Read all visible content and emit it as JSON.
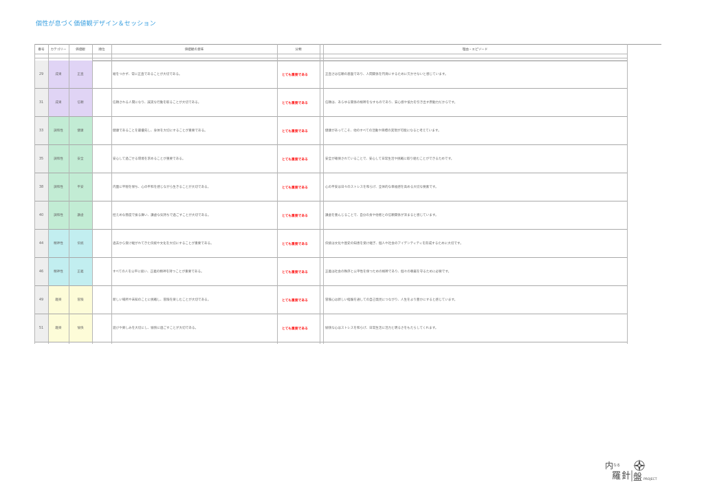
{
  "title": "個性が息づく価値観デザイン＆セッション",
  "columns": {
    "number": "番号",
    "category": "カテゴリー",
    "value": "価値観",
    "rank": "順位",
    "meaning": "価値観の意味",
    "classification": "分類",
    "reason": "理由・エピソード"
  },
  "colors": {
    "成果": "#e0d4f5",
    "調和性": "#c2ecd4",
    "精神性": "#c2eef0",
    "趣楽": "#fdfcd8",
    "classification": "#ff1a1a"
  },
  "rows": [
    {
      "num": "29",
      "category": "成果",
      "value": "正直",
      "meaning": "嘘をつかず、常に正直であることが大切である。",
      "classification": "とても重要である",
      "reason": "正直さは信頼の基盤であり、人間関係を円滑にするために欠かせないと感じています。"
    },
    {
      "num": "31",
      "category": "成果",
      "value": "信頼",
      "meaning": "信頼される人間になり、誠実な行動を取ることが大切である。",
      "classification": "とても重要である",
      "reason": "信頼は、あらゆる関係の根幹をなすものであり、安心感や協力を引き出す原動力だからです。"
    },
    {
      "num": "33",
      "category": "調和性",
      "value": "健康",
      "meaning": "健康であることを最優先し、身体を大切にすることが重要である。",
      "classification": "とても重要である",
      "reason": "健康があってこそ、他のすべての活動や目標の実現が可能になると考えています。"
    },
    {
      "num": "35",
      "category": "調和性",
      "value": "安全",
      "meaning": "安心して過ごせる環境を求めることが重要である。",
      "classification": "とても重要である",
      "reason": "安全が確保されていることで、安心して日常生活や挑戦に取り組むことができるためです。"
    },
    {
      "num": "38",
      "category": "調和性",
      "value": "平安",
      "meaning": "内面に平穏を保ち、心の平和を感じながら生きることが大切である。",
      "classification": "とても重要である",
      "reason": "心の平安は日々のストレスを和らげ、全体的な幸福感を高める大切な要素です。"
    },
    {
      "num": "40",
      "category": "調和性",
      "value": "謙虚",
      "meaning": "控えめな態度で振る舞い、謙虚な気持ちで過ごすことが大切である。",
      "classification": "とても重要である",
      "reason": "謙虚を重んじることで、自分の身や他者との信頼関係が深まると感じています。"
    },
    {
      "num": "44",
      "category": "精神性",
      "value": "伝統",
      "meaning": "過去から受け継がれてきた伝統や文化を大切にすることが重要である。",
      "classification": "とても重要である",
      "reason": "伝統は文化や歴史の知恵を受け継ぎ、個人や社会のアイデンティティを形成するために大切です。"
    },
    {
      "num": "46",
      "category": "精神性",
      "value": "正義",
      "meaning": "すべての人を公平に扱い、正義の精神を持つことが重要である。",
      "classification": "とても重要である",
      "reason": "正義は社会の秩序と公平性を保つための根幹であり、個々の尊厳を守るために必要です。"
    },
    {
      "num": "49",
      "category": "趣楽",
      "value": "冒険",
      "meaning": "新しい場所や未知のことに挑戦し、冒険を楽しむことが大切である。",
      "classification": "とても重要である",
      "reason": "冒険心は新しい経験を通しての自己発見につながり、人生をより豊かにすると感じています。"
    },
    {
      "num": "51",
      "category": "趣楽",
      "value": "愉快",
      "meaning": "遊びや楽しみを大切にし、愉快に過ごすことが大切である。",
      "classification": "とても重要である",
      "reason": "愉快な心はストレスを和らげ、日常生活に活力と明るさをもたらしてくれます。"
    }
  ],
  "logo": {
    "mark": "内なる羅針盤",
    "suffix": "PROJECT"
  }
}
